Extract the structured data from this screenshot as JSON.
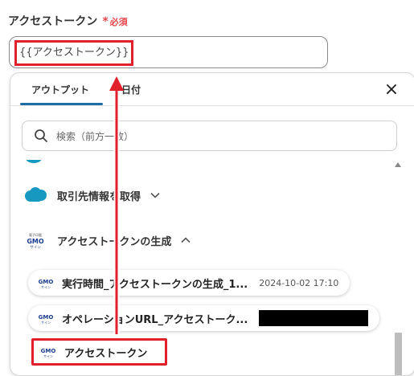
{
  "field": {
    "label": "アクセストークン",
    "required_mark": "*",
    "required_text": "必須",
    "value": "{{アクセストークン}}"
  },
  "popup": {
    "tabs": [
      {
        "label": "アウトプット",
        "active": true
      },
      {
        "label": "日付",
        "active": false
      }
    ],
    "close_icon": "×",
    "search": {
      "placeholder": "検索（前方一致）"
    },
    "cut_item": {
      "label": "..."
    },
    "sections": [
      {
        "title": "取引先情報を取得",
        "icon": "salesforce-cloud-icon",
        "expanded": false
      },
      {
        "title": "アクセストークンの生成",
        "icon": "gmo-sign-logo-icon",
        "expanded": true
      }
    ],
    "outputs": [
      {
        "label": "実行時間_アクセストークンの生成_1...",
        "value": "2024-10-02 17:10"
      },
      {
        "label": "オペレーションURL_アクセストーク...",
        "value": "[redacted]"
      },
      {
        "label": "アクセストークン",
        "value": ""
      }
    ]
  },
  "logo": {
    "gmo_text": "GMO",
    "gmo_sub": "サイン"
  },
  "colors": {
    "accent": "#1c6ea4",
    "highlight": "#e0202a",
    "required": "#e5484d",
    "salesforce": "#1798c1"
  }
}
